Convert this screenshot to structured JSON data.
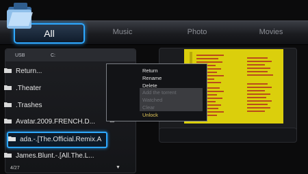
{
  "tabs": [
    {
      "label": "All",
      "active": true
    },
    {
      "label": "Music"
    },
    {
      "label": "Photo"
    },
    {
      "label": "Movies"
    }
  ],
  "browser": {
    "drive_label": "USB",
    "path_label": "C:",
    "items": [
      {
        "label": "Return..."
      },
      {
        "label": ".Theater"
      },
      {
        "label": ".Trashes"
      },
      {
        "label": "Avatar.2009.FRENCH.D..."
      },
      {
        "label": "ada.-.[The.Official.Remix.A",
        "selected": true
      },
      {
        "label": "James.Blunt.-.[All.The.L..."
      }
    ],
    "page_count": "4/27",
    "scroll_glyph": "▼",
    "side_glyph": "⊞"
  },
  "context_menu": {
    "items": [
      {
        "label": "Return",
        "state": "enabled"
      },
      {
        "label": "Rename",
        "state": "enabled"
      },
      {
        "label": "Delete",
        "state": "enabled"
      },
      {
        "label": "Add the torrent",
        "state": "disabled"
      },
      {
        "label": "Watched",
        "state": "disabled"
      },
      {
        "label": "Clear",
        "state": "disabled"
      },
      {
        "label": "Unlock",
        "state": "highlight"
      }
    ]
  },
  "colors": {
    "accent": "#2ea8ff",
    "poster": "#ddd10a",
    "menu_highlight": "#e4c95a"
  },
  "icons": {
    "app": "folder-app-icon",
    "row": "folder-icon"
  }
}
